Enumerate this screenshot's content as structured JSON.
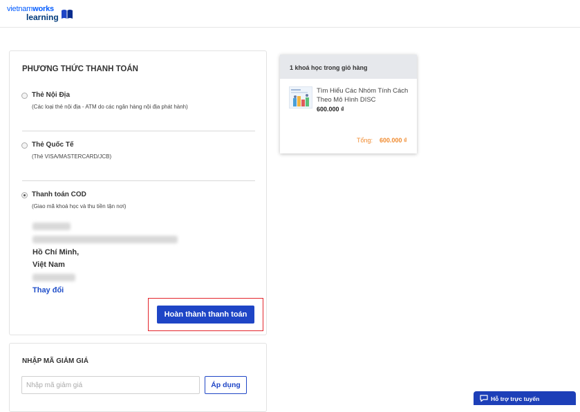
{
  "logo": {
    "line1_a": "vietnam",
    "line1_b": "works",
    "line2": "learning"
  },
  "payment": {
    "title": "PHƯƠNG THỨC THANH TOÁN",
    "options": [
      {
        "label": "Thẻ Nội Địa",
        "desc": "(Các loại thẻ nội địa - ATM do các ngân hàng nội địa phát hành)",
        "checked": false
      },
      {
        "label": "Thẻ Quốc Tế",
        "desc": "(Thẻ VISA/MASTERCARD/JCB)",
        "checked": false
      },
      {
        "label": "Thanh toán COD",
        "desc": "(Giao mã khoá học và thu tiền tận nơi)",
        "checked": true
      }
    ],
    "address": {
      "city": "Hồ Chí Minh,",
      "country": "Việt Nam",
      "change_label": "Thay đổi"
    },
    "complete_label": "Hoàn thành thanh toán"
  },
  "coupon": {
    "title": "NHẬP MÃ GIẢM GIÁ",
    "placeholder": "Nhập mã giảm giá",
    "apply_label": "Áp dụng"
  },
  "cart": {
    "header": "1 khoá học trong giỏ hàng",
    "items": [
      {
        "name": "Tìm Hiểu Các Nhóm Tính Cách Theo Mô Hình DISC",
        "price": "600.000 ₫"
      }
    ],
    "total_label": "Tổng:",
    "total_value": "600.000 ₫"
  },
  "support": {
    "label": "Hỗ trợ trực tuyến"
  },
  "colors": {
    "primary": "#1e45c6",
    "highlight": "#e3232a",
    "accent": "#f08a2e"
  }
}
